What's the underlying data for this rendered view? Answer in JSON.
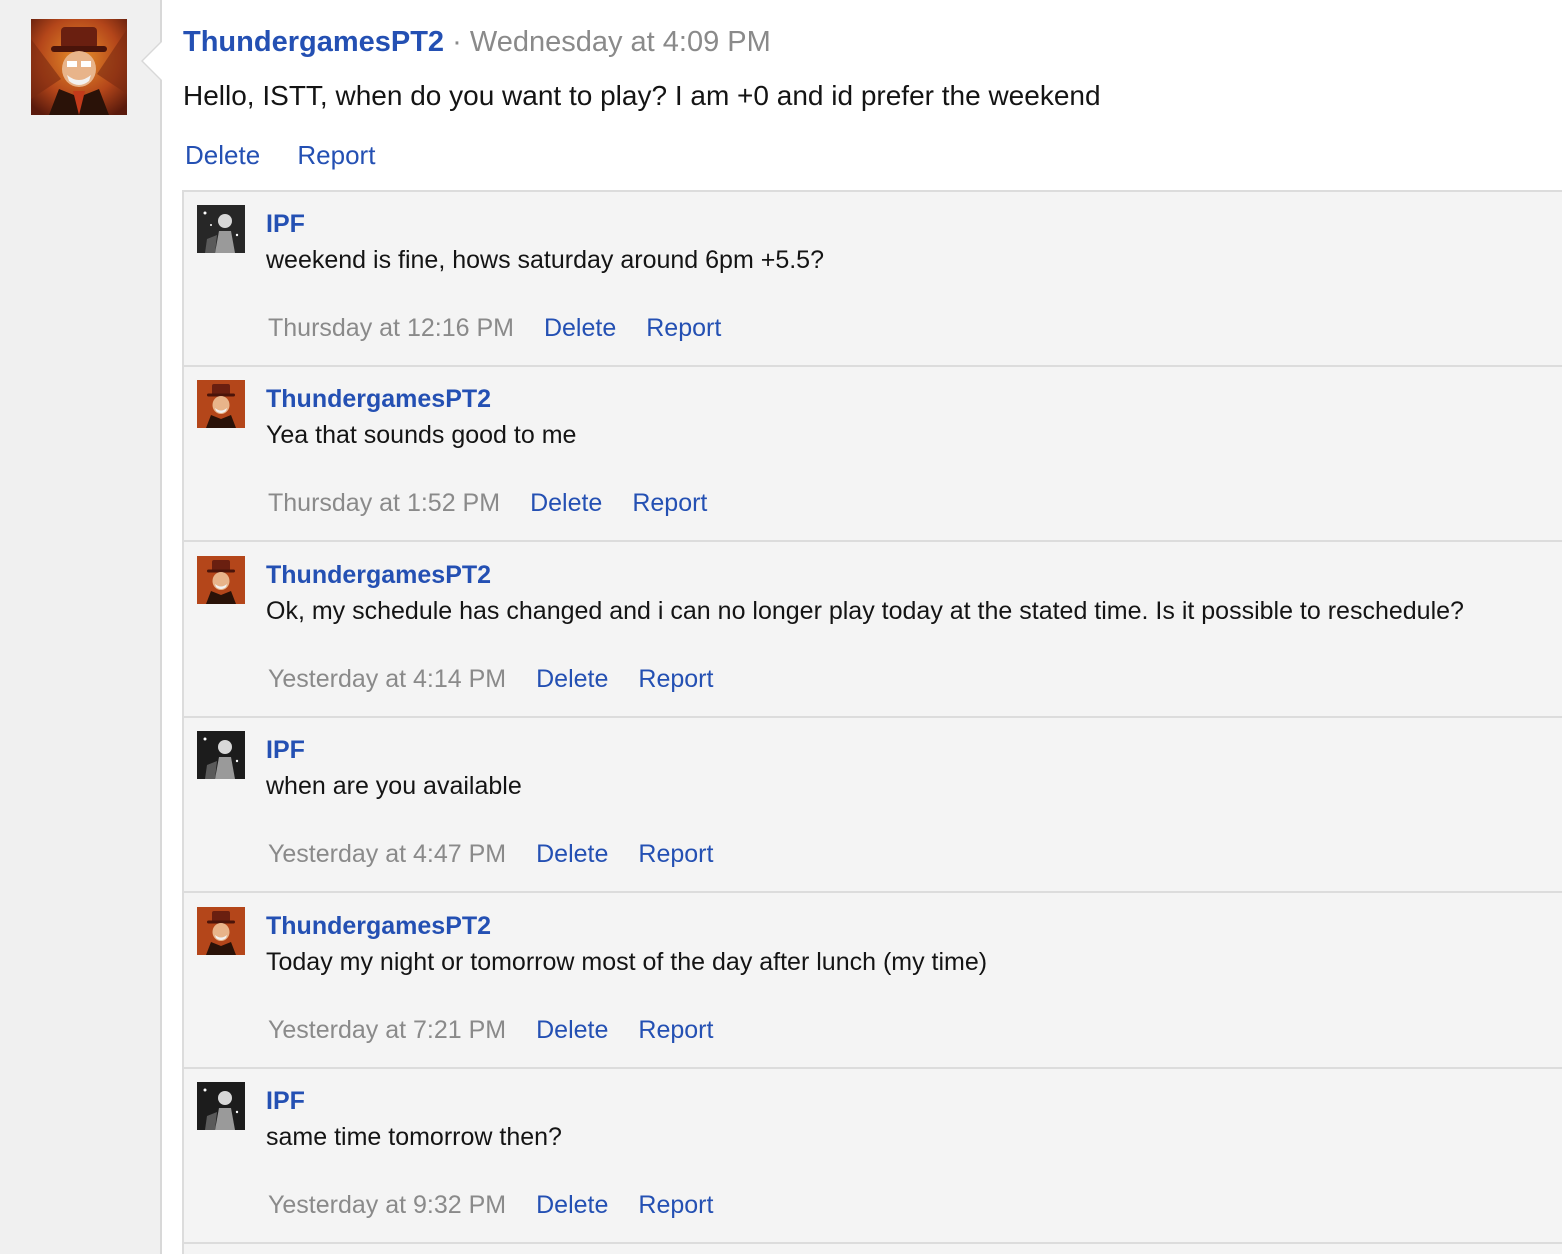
{
  "post": {
    "author": "ThundergamesPT2",
    "separator": "·",
    "time": "Wednesday at 4:09 PM",
    "body": "Hello, ISTT, when do you want to play? I am +0 and id prefer the weekend",
    "delete_label": "Delete",
    "report_label": "Report"
  },
  "comments": [
    {
      "author": "IPF",
      "avatar": "ipf-avatar-icon",
      "text": "weekend is fine, hows saturday around 6pm +5.5?",
      "time": "Thursday at 12:16 PM",
      "delete_label": "Delete",
      "report_label": "Report"
    },
    {
      "author": "ThundergamesPT2",
      "avatar": "thunder-avatar-icon",
      "text": "Yea that sounds good to me",
      "time": "Thursday at 1:52 PM",
      "delete_label": "Delete",
      "report_label": "Report"
    },
    {
      "author": "ThundergamesPT2",
      "avatar": "thunder-avatar-icon",
      "text": "Ok, my schedule has changed and i can no longer play today at the stated time. Is it possible to reschedule?",
      "time": "Yesterday at 4:14 PM",
      "delete_label": "Delete",
      "report_label": "Report"
    },
    {
      "author": "IPF",
      "avatar": "ipf-avatar-icon",
      "text": "when are you available",
      "time": "Yesterday at 4:47 PM",
      "delete_label": "Delete",
      "report_label": "Report"
    },
    {
      "author": "ThundergamesPT2",
      "avatar": "thunder-avatar-icon",
      "text": "Today my night or tomorrow most of the day after lunch (my time)",
      "time": "Yesterday at 7:21 PM",
      "delete_label": "Delete",
      "report_label": "Report"
    },
    {
      "author": "IPF",
      "avatar": "ipf-avatar-icon",
      "text": "same time tomorrow then?",
      "time": "Yesterday at 9:32 PM",
      "delete_label": "Delete",
      "report_label": "Report"
    }
  ],
  "colors": {
    "link": "#2450b3",
    "muted": "#8a8a8a",
    "comment_bg": "#f4f4f4",
    "sidebar_bg": "#f0f0f0"
  }
}
